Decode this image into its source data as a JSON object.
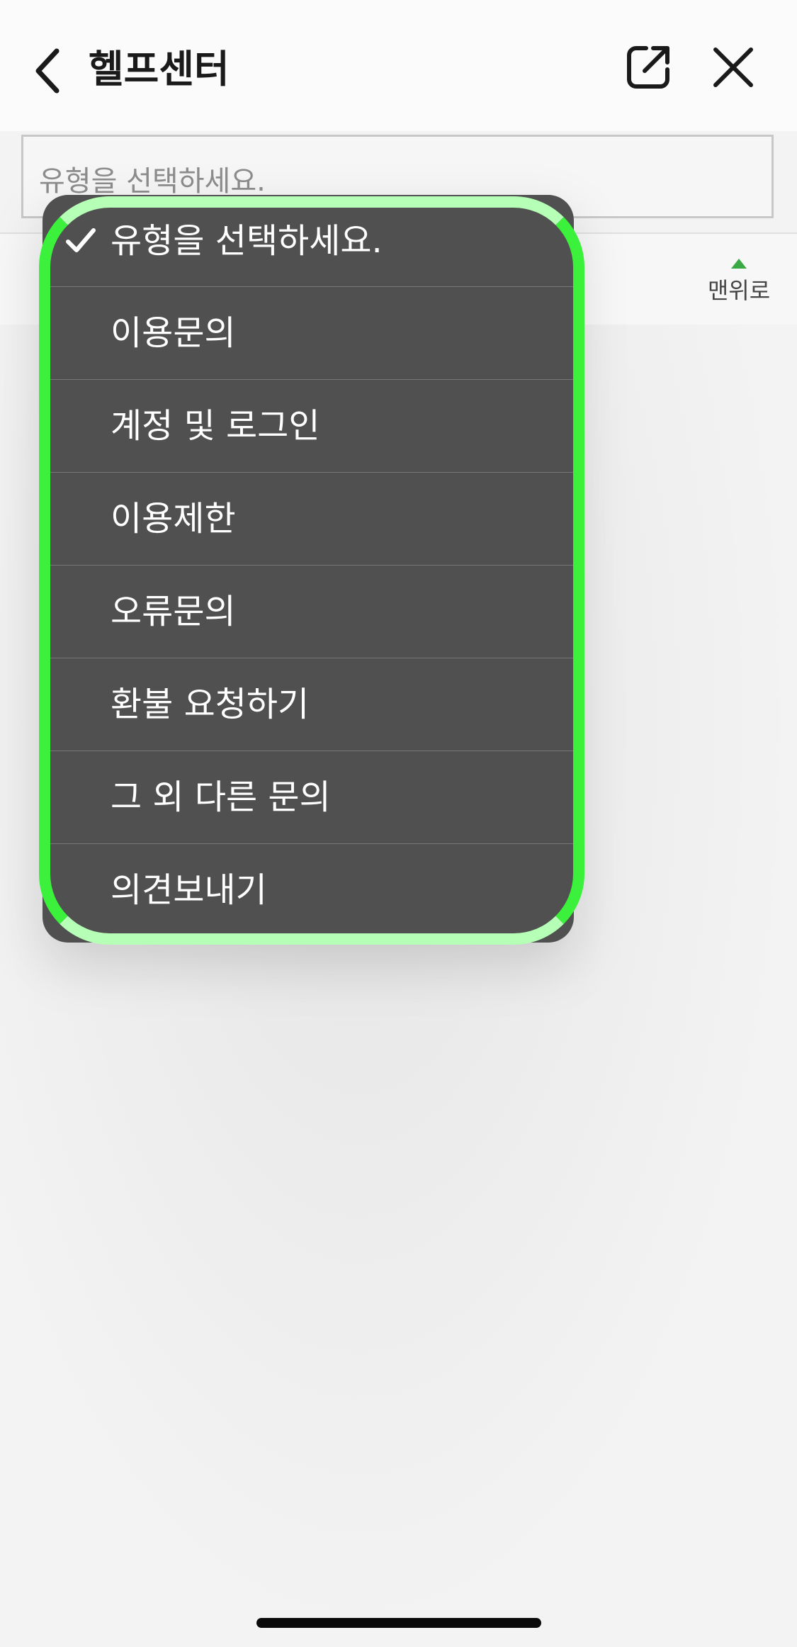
{
  "header": {
    "title": "헬프센터"
  },
  "form": {
    "type_select_placeholder": "유형을 선택하세요."
  },
  "scroll_top": {
    "label": "맨위로"
  },
  "dropdown": {
    "selected_index": 0,
    "options": [
      {
        "label": "유형을 선택하세요.",
        "selected": true
      },
      {
        "label": "이용문의",
        "selected": false
      },
      {
        "label": "계정 및 로그인",
        "selected": false
      },
      {
        "label": "이용제한",
        "selected": false
      },
      {
        "label": "오류문의",
        "selected": false
      },
      {
        "label": "환불 요청하기",
        "selected": false
      },
      {
        "label": "그 외 다른 문의",
        "selected": false
      },
      {
        "label": "의견보내기",
        "selected": false
      }
    ]
  },
  "colors": {
    "menu_bg": "#505050",
    "highlight_green": "#3cf13c",
    "top_arrow": "#3aa843"
  },
  "icons": {
    "back": "chevron-left-icon",
    "share": "external-link-icon",
    "close": "close-icon",
    "check": "check-icon"
  }
}
